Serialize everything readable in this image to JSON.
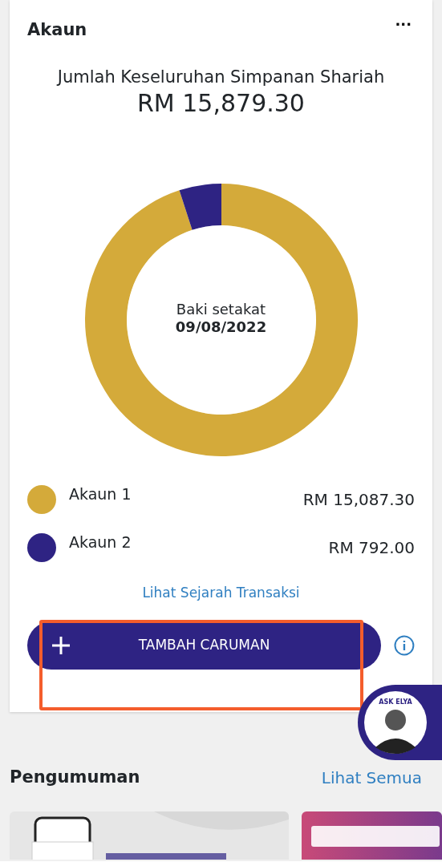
{
  "account_card": {
    "title": "Akaun",
    "menu_icon": "···",
    "total_label": "Jumlah Keseluruhan Simpanan Shariah",
    "total_amount": "RM 15,879.30",
    "chart_data": {
      "type": "donut",
      "categories": [
        "Akaun 1",
        "Akaun 2"
      ],
      "series": [
        {
          "values": [
            95.01,
            4.99
          ]
        }
      ]
    },
    "center_label": "Baki setakat",
    "center_date": "09/08/2022",
    "legend": [
      {
        "amount": "RM 15,087.30",
        "color": "#d4aa3a"
      },
      {
        "amount": "RM 792.00",
        "color": "#2e2383"
      }
    ],
    "history_link": "Lihat Sejarah Transaksi",
    "add_button": {
      "label": "TAMBAH CARUMAN"
    },
    "highlighted": true
  },
  "chat_button": {
    "label": "ASK ELYA"
  },
  "announcements": {
    "title": "Pengumuman",
    "see_all": "Lihat Semua"
  }
}
